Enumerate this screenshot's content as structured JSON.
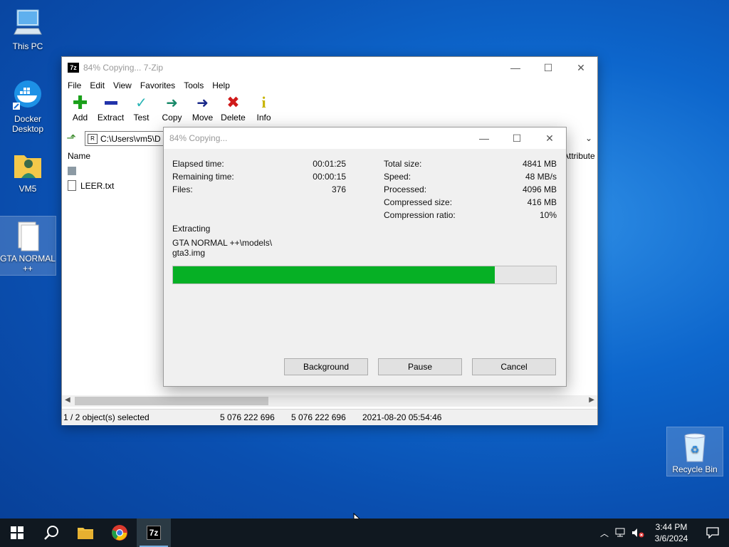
{
  "desktop": {
    "icons": [
      {
        "label": "This PC"
      },
      {
        "label": "Docker\nDesktop"
      },
      {
        "label": "VM5"
      },
      {
        "label": "GTA NORMAL\n++"
      },
      {
        "label": "Recycle Bin"
      }
    ]
  },
  "main_window": {
    "title": "84% Copying... 7-Zip",
    "app_icon_text": "7z",
    "menu": [
      "File",
      "Edit",
      "View",
      "Favorites",
      "Tools",
      "Help"
    ],
    "toolbar": [
      "Add",
      "Extract",
      "Test",
      "Copy",
      "Move",
      "Delete",
      "Info"
    ],
    "address": "C:\\Users\\vm5\\D",
    "columns": {
      "name": "Name",
      "attributes": "Attribute"
    },
    "files": [
      {
        "name": "",
        "type": "folder"
      },
      {
        "name": "LEER.txt",
        "type": "file"
      }
    ],
    "status": {
      "selected": "1 / 2 object(s) selected",
      "size": "5 076 222 696",
      "packed": "5 076 222 696",
      "modified": "2021-08-20 05:54:46"
    }
  },
  "dialog": {
    "title": "84% Copying...",
    "elapsed_label": "Elapsed time:",
    "elapsed": "00:01:25",
    "remaining_label": "Remaining time:",
    "remaining": "00:00:15",
    "files_label": "Files:",
    "files": "376",
    "total_label": "Total size:",
    "total": "4841 MB",
    "speed_label": "Speed:",
    "speed": "48 MB/s",
    "processed_label": "Processed:",
    "processed": "4096 MB",
    "compressed_label": "Compressed size:",
    "compressed": "416 MB",
    "ratio_label": "Compression ratio:",
    "ratio": "10%",
    "operation": "Extracting",
    "path_line1": "GTA NORMAL ++\\models\\",
    "path_line2": "gta3.img",
    "progress_percent": 84,
    "buttons": {
      "background": "Background",
      "pause": "Pause",
      "cancel": "Cancel"
    }
  },
  "taskbar": {
    "time": "3:44 PM",
    "date": "3/6/2024",
    "active_app_text": "7z"
  },
  "colors": {
    "progress": "#06b025",
    "accent": "#0a64c8"
  }
}
